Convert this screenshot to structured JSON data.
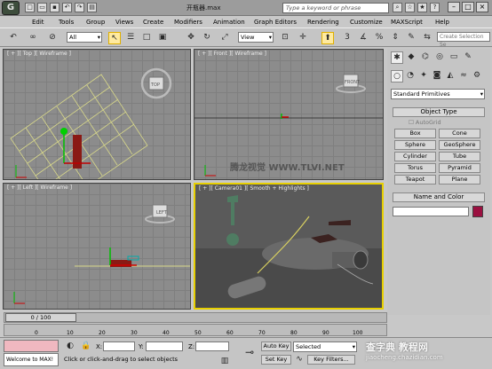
{
  "window": {
    "title": "开瓶器.max",
    "search_placeholder": "Type a keyword or phrase"
  },
  "menu": [
    "Edit",
    "Tools",
    "Group",
    "Views",
    "Create",
    "Modifiers",
    "Animation",
    "Graph Editors",
    "Rendering",
    "Customize",
    "MAXScript",
    "Help"
  ],
  "toolbar": {
    "selection_filter": "All",
    "ref_coord": "View",
    "named_selection": "Create Selection Se"
  },
  "viewports": {
    "top": "[ + ][ Top ][ Wireframe ]",
    "front": "[ + ][ Front ][ Wireframe ]",
    "left": "[ + ][ Left ][ Wireframe ]",
    "camera": "[ + ][ Camera01 ][ Smooth + Highlights ]",
    "viewcube_top": "TOP",
    "viewcube_front": "FRONT",
    "viewcube_left": "LEFT",
    "watermark": "腾龙视觉 WWW.TLVI.NET"
  },
  "command_panel": {
    "category": "Standard Primitives",
    "object_type_title": "Object Type",
    "autogrid": "AutoGrid",
    "buttons": [
      "Box",
      "Cone",
      "Sphere",
      "GeoSphere",
      "Cylinder",
      "Tube",
      "Torus",
      "Pyramid",
      "Teapot",
      "Plane"
    ],
    "name_color_title": "Name and Color",
    "object_color": "#9b1040"
  },
  "timeline": {
    "position": "0 / 100",
    "ticks": [
      "0",
      "10",
      "20",
      "30",
      "40",
      "50",
      "60",
      "70",
      "80",
      "90",
      "100"
    ],
    "progress": 0.0
  },
  "status": {
    "script_text": "Welcome to MAX!",
    "prompt": "Click or click-and-drag to select objects",
    "x_label": "X:",
    "y_label": "Y:",
    "z_label": "Z:",
    "auto_key": "Auto Key",
    "set_key": "Set Key",
    "selected": "Selected",
    "key_filters": "Key Filters...",
    "watermark1": "查字典 教程网",
    "watermark2": "jiaocheng.chazidian.com"
  }
}
